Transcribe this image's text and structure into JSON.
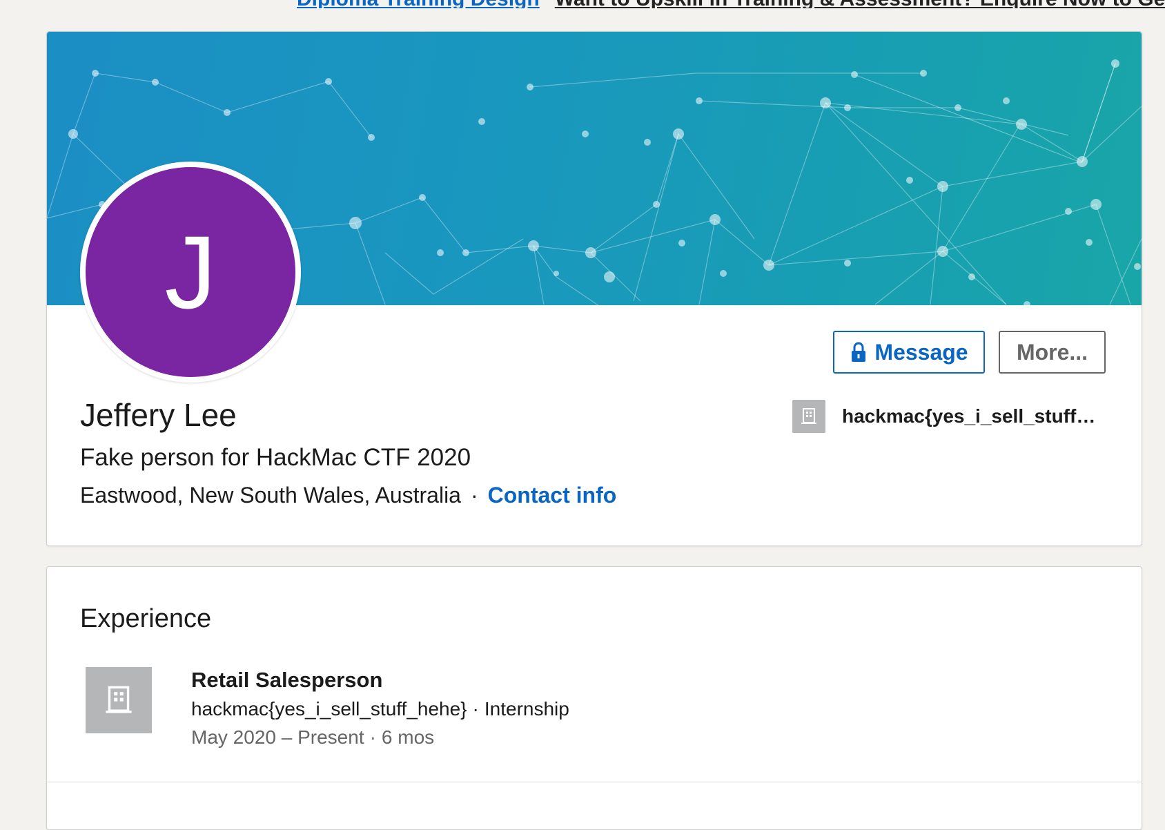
{
  "ad": {
    "link_text": "Diploma Training Design",
    "text": "Want to Upskill in Training & Assessment? Enquire Now to Get"
  },
  "profile": {
    "avatar_initial": "J",
    "name": "Jeffery Lee",
    "headline": "Fake person for HackMac CTF 2020",
    "location": "Eastwood, New South Wales, Australia",
    "separator": "·",
    "contact_info_label": "Contact info",
    "current_company": "hackmac{yes_i_sell_stuff_hehe}",
    "company_icon": "building-icon"
  },
  "actions": {
    "message_label": "Message",
    "message_icon": "lock-icon",
    "more_label": "More..."
  },
  "experience": {
    "title": "Experience",
    "items": [
      {
        "role": "Retail Salesperson",
        "company": "hackmac{yes_i_sell_stuff_hehe}",
        "employment_type": "Internship",
        "date_range": "May 2020 – Present",
        "duration": "6 mos",
        "separator": "·"
      }
    ]
  },
  "colors": {
    "accent": "#0a66c2",
    "avatar_bg": "#7a25a1",
    "banner_start": "#1b8ec4",
    "banner_end": "#19a6a8",
    "logo_placeholder": "#b4b6b8"
  }
}
